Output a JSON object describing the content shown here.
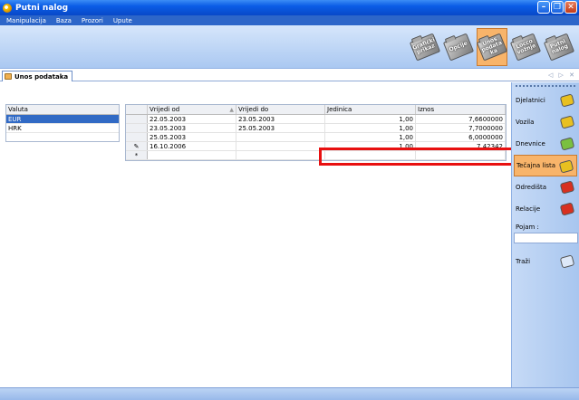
{
  "window": {
    "title": "Putni nalog"
  },
  "menu": [
    "Manipulacija",
    "Baza",
    "Prozori",
    "Upute"
  ],
  "toolbar": [
    {
      "label": "Grafički prikaz",
      "active": false
    },
    {
      "label": "Opcije",
      "active": false
    },
    {
      "label": "Unos podataka",
      "active": true
    },
    {
      "label": "Locco vožnje",
      "active": false
    },
    {
      "label": "Putni nalog",
      "active": false
    }
  ],
  "tab": {
    "label": "Unos podataka"
  },
  "currency_list": {
    "header": "Valuta",
    "items": [
      "EUR",
      "HRK"
    ],
    "selected": "EUR"
  },
  "grid": {
    "columns": [
      "Vrijedi od",
      "Vrijedi do",
      "Jedinica",
      "Iznos"
    ],
    "rows": [
      {
        "indicator": "",
        "od": "22.05.2003",
        "do": "23.05.2003",
        "jedinica": "1,00",
        "iznos": "7,6600000"
      },
      {
        "indicator": "",
        "od": "23.05.2003",
        "do": "25.05.2003",
        "jedinica": "1,00",
        "iznos": "7,7000000"
      },
      {
        "indicator": "",
        "od": "25.05.2003",
        "do": "",
        "jedinica": "1,00",
        "iznos": "6,0000000"
      },
      {
        "indicator": "✎",
        "od": "16.10.2006",
        "do": "",
        "jedinica": "1,00",
        "iznos": "7,42342"
      },
      {
        "indicator": "*",
        "od": "",
        "do": "",
        "jedinica": "",
        "iznos": ""
      }
    ]
  },
  "sidepanel": {
    "items": [
      {
        "label": "Djelatnici",
        "icon_color": "#e8c020",
        "active": false
      },
      {
        "label": "Vozila",
        "icon_color": "#e8c020",
        "active": false
      },
      {
        "label": "Dnevnice",
        "icon_color": "#7ac040",
        "active": false
      },
      {
        "label": "Tečajna lista",
        "icon_color": "#e8c020",
        "active": true
      },
      {
        "label": "Odredišta",
        "icon_color": "#d83020",
        "active": false
      },
      {
        "label": "Relacije",
        "icon_color": "#d83020",
        "active": false
      }
    ],
    "pojam_label": "Pojam :",
    "pojam_value": "",
    "search_label": "Traži"
  },
  "colors": {
    "highlight": "#e81010",
    "selected": "#316ac5",
    "active_tool": "#f8b46a"
  }
}
